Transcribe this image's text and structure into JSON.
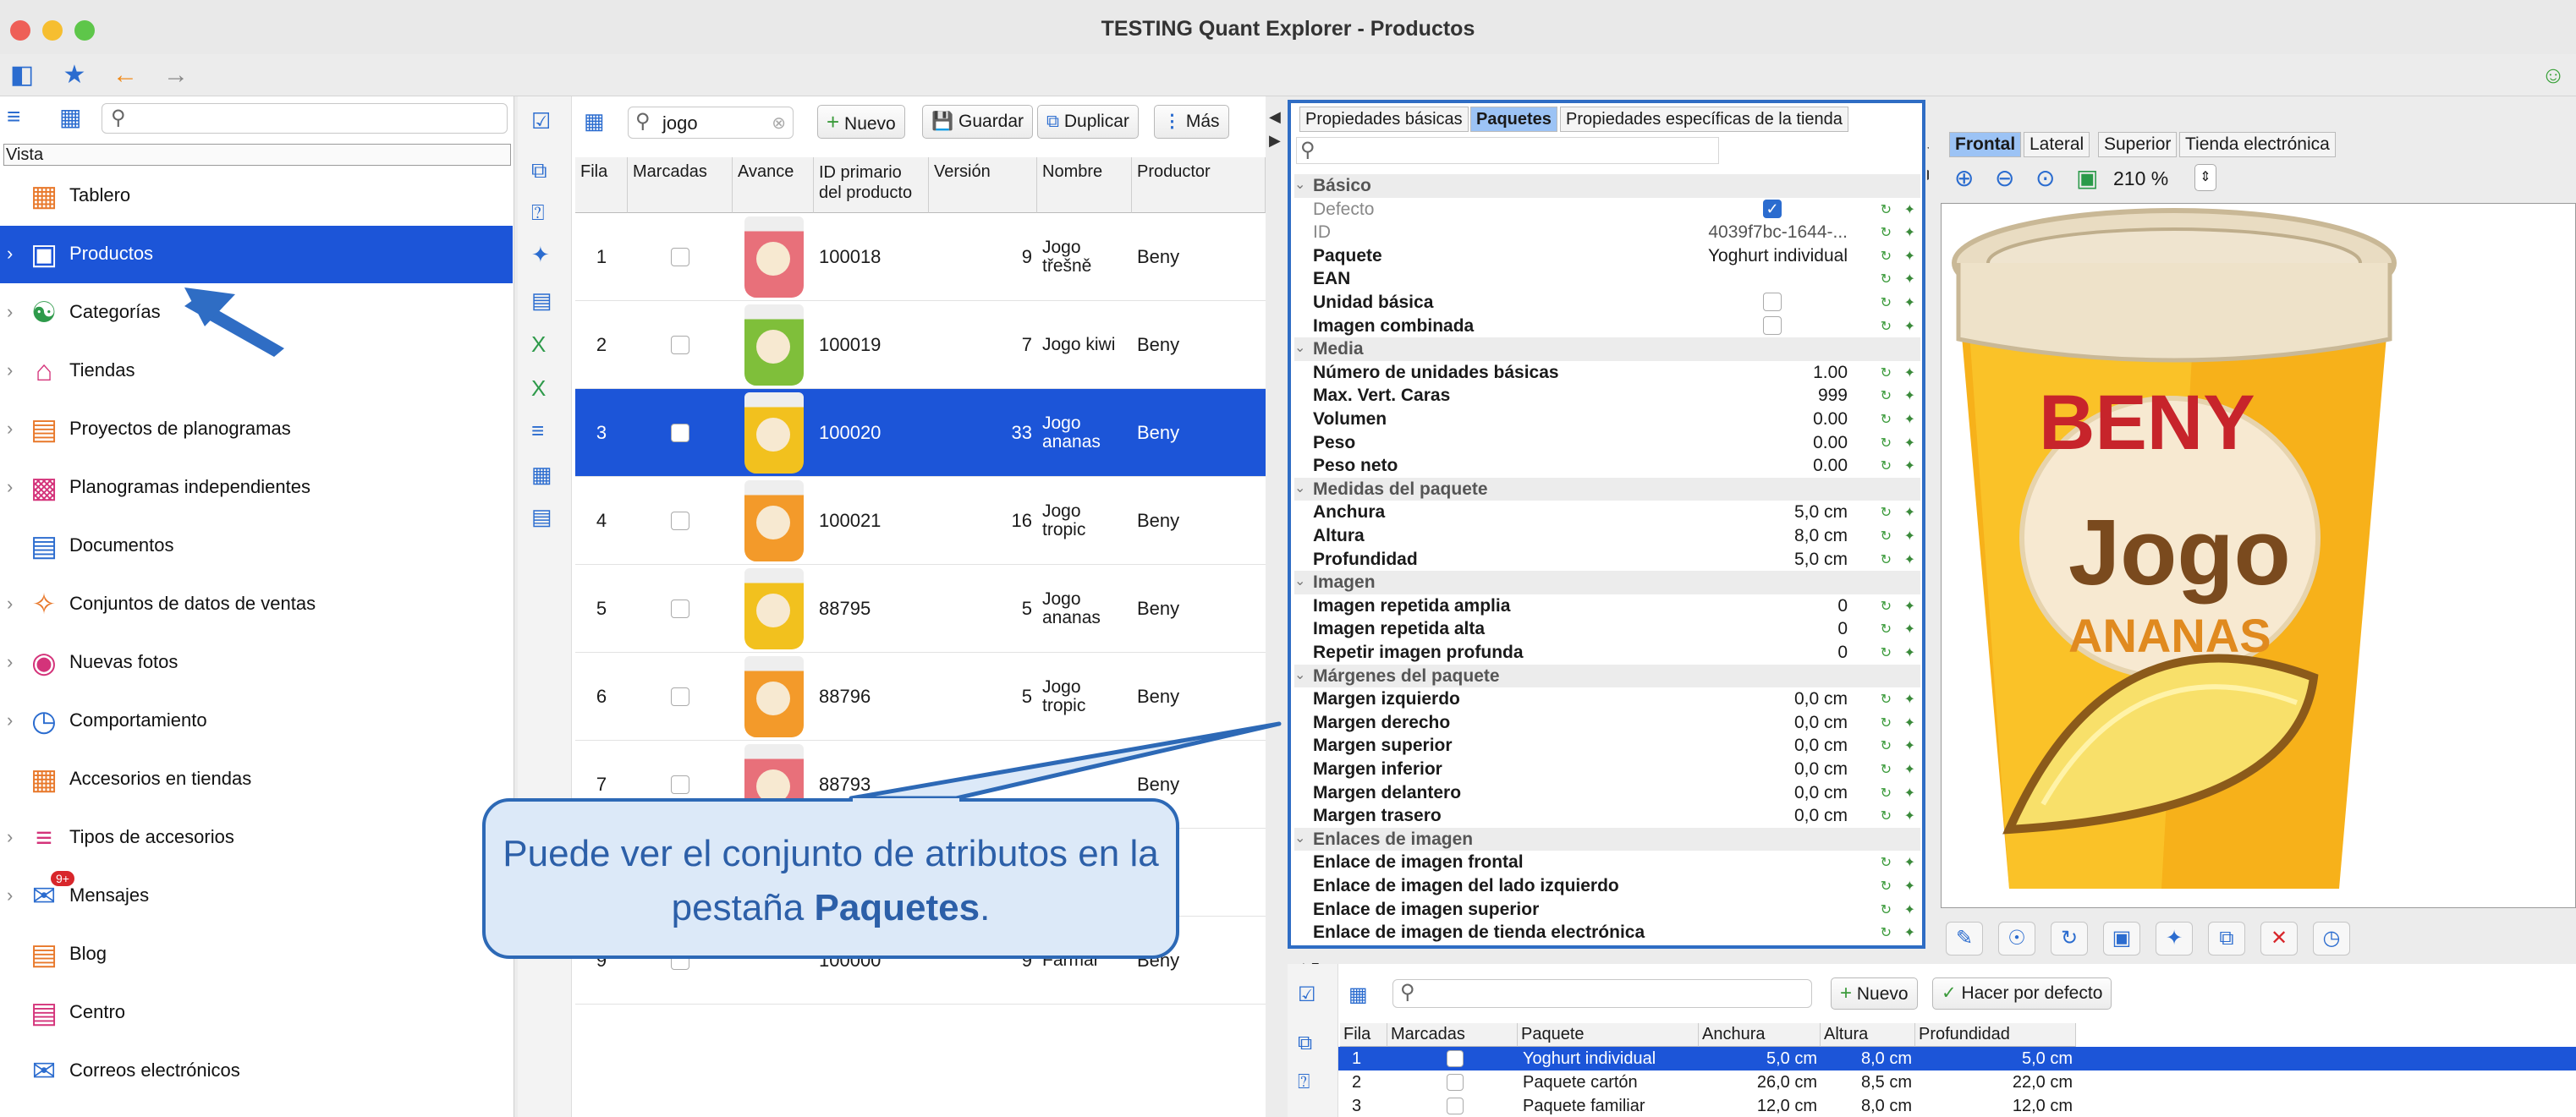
{
  "window": {
    "title": "TESTING Quant Explorer - Productos"
  },
  "sidebar": {
    "vista_label": "Vista",
    "items": [
      {
        "label": "Tablero",
        "icon": "dashboard-icon",
        "chevron": false,
        "selected": false
      },
      {
        "label": "Productos",
        "icon": "product-box-icon",
        "chevron": true,
        "selected": true
      },
      {
        "label": "Categorías",
        "icon": "category-tree-icon",
        "chevron": true,
        "selected": false
      },
      {
        "label": "Tiendas",
        "icon": "store-icon",
        "chevron": true,
        "selected": false
      },
      {
        "label": "Proyectos de planogramas",
        "icon": "planogram-project-icon",
        "chevron": true,
        "selected": false
      },
      {
        "label": "Planogramas independientes",
        "icon": "planogram-icon",
        "chevron": true,
        "selected": false
      },
      {
        "label": "Documentos",
        "icon": "documents-icon",
        "chevron": false,
        "selected": false
      },
      {
        "label": "Conjuntos de datos de ventas",
        "icon": "sales-data-icon",
        "chevron": true,
        "selected": false
      },
      {
        "label": "Nuevas fotos",
        "icon": "camera-icon",
        "chevron": true,
        "selected": false
      },
      {
        "label": "Comportamiento",
        "icon": "behavior-icon",
        "chevron": true,
        "selected": false
      },
      {
        "label": "Accesorios en tiendas",
        "icon": "accessories-icon",
        "chevron": false,
        "selected": false
      },
      {
        "label": "Tipos de accesorios",
        "icon": "accessory-types-icon",
        "chevron": true,
        "selected": false
      },
      {
        "label": "Mensajes",
        "icon": "messages-icon",
        "chevron": true,
        "selected": false,
        "badge": "9+"
      },
      {
        "label": "Blog",
        "icon": "blog-icon",
        "chevron": false,
        "selected": false
      },
      {
        "label": "Centro",
        "icon": "center-icon",
        "chevron": false,
        "selected": false
      },
      {
        "label": "Correos electrónicos",
        "icon": "email-icon",
        "chevron": false,
        "selected": false
      }
    ]
  },
  "list_toolbar": {
    "search_value": "jogo",
    "nuevo": "Nuevo",
    "guardar": "Guardar",
    "duplicar": "Duplicar",
    "mas": "Más"
  },
  "product_table": {
    "headers": {
      "fila": "Fila",
      "marcadas": "Marcadas",
      "avance": "Avance",
      "id": "ID primario del producto",
      "version": "Versión",
      "nombre": "Nombre",
      "productor": "Productor"
    },
    "rows": [
      {
        "fila": "1",
        "id": "100018",
        "version": "9",
        "nombre": "Jogo třešně",
        "productor": "Beny",
        "color": "#e8707a",
        "selected": false
      },
      {
        "fila": "2",
        "id": "100019",
        "version": "7",
        "nombre": "Jogo kiwi",
        "productor": "Beny",
        "color": "#7fbf3a",
        "selected": false
      },
      {
        "fila": "3",
        "id": "100020",
        "version": "33",
        "nombre": "Jogo ananas",
        "productor": "Beny",
        "color": "#f2c11e",
        "selected": true
      },
      {
        "fila": "4",
        "id": "100021",
        "version": "16",
        "nombre": "Jogo tropic",
        "productor": "Beny",
        "color": "#f39a2a",
        "selected": false
      },
      {
        "fila": "5",
        "id": "88795",
        "version": "5",
        "nombre": "Jogo ananas",
        "productor": "Beny",
        "color": "#f2c11e",
        "selected": false
      },
      {
        "fila": "6",
        "id": "88796",
        "version": "5",
        "nombre": "Jogo tropic",
        "productor": "Beny",
        "color": "#f39a2a",
        "selected": false
      },
      {
        "fila": "7",
        "id": "88793",
        "version": "",
        "nombre": "",
        "productor": "Beny",
        "color": "#e8707a",
        "selected": false
      },
      {
        "fila": "",
        "id": "",
        "version": "",
        "nombre": "",
        "productor": "Beny",
        "color": "",
        "selected": false
      },
      {
        "fila": "9",
        "id": "100000",
        "version": "9",
        "nombre": "Farmář",
        "productor": "Beny",
        "color": "",
        "selected": false
      }
    ]
  },
  "properties": {
    "tabs": [
      "Propiedades básicas",
      "Paquetes",
      "Propiedades específicas de la tienda"
    ],
    "active_tab": 1,
    "rows": [
      {
        "type": "section",
        "label": "Básico"
      },
      {
        "label": "Defecto",
        "value": "",
        "check": "checked",
        "muted": true
      },
      {
        "label": "ID",
        "value": "4039f7bc-1644-...",
        "muted": true
      },
      {
        "label": "Paquete",
        "value": "Yoghurt individual"
      },
      {
        "label": "EAN",
        "value": ""
      },
      {
        "label": "Unidad básica",
        "value": "",
        "check": "empty"
      },
      {
        "label": "Imagen combinada",
        "value": "",
        "check": "empty"
      },
      {
        "type": "section",
        "label": "Media"
      },
      {
        "label": "Número de unidades básicas",
        "value": "1.00"
      },
      {
        "label": "Max. Vert. Caras",
        "value": "999"
      },
      {
        "label": "Volumen",
        "value": "0.00"
      },
      {
        "label": "Peso",
        "value": "0.00"
      },
      {
        "label": "Peso neto",
        "value": "0.00"
      },
      {
        "type": "section",
        "label": "Medidas del paquete"
      },
      {
        "label": "Anchura",
        "value": "5,0 cm"
      },
      {
        "label": "Altura",
        "value": "8,0 cm"
      },
      {
        "label": "Profundidad",
        "value": "5,0 cm"
      },
      {
        "type": "section",
        "label": "Imagen"
      },
      {
        "label": "Imagen repetida amplia",
        "value": "0"
      },
      {
        "label": "Imagen repetida alta",
        "value": "0"
      },
      {
        "label": "Repetir imagen profunda",
        "value": "0"
      },
      {
        "type": "section",
        "label": "Márgenes del paquete"
      },
      {
        "label": "Margen izquierdo",
        "value": "0,0 cm"
      },
      {
        "label": "Margen derecho",
        "value": "0,0 cm"
      },
      {
        "label": "Margen superior",
        "value": "0,0 cm"
      },
      {
        "label": "Margen inferior",
        "value": "0,0 cm"
      },
      {
        "label": "Margen delantero",
        "value": "0,0 cm"
      },
      {
        "label": "Margen trasero",
        "value": "0,0 cm"
      },
      {
        "type": "section",
        "label": "Enlaces de imagen"
      },
      {
        "label": "Enlace de imagen frontal",
        "value": ""
      },
      {
        "label": "Enlace de imagen del lado izquierdo",
        "value": ""
      },
      {
        "label": "Enlace de imagen superior",
        "value": ""
      },
      {
        "label": "Enlace de imagen de tienda electrónica",
        "value": ""
      }
    ]
  },
  "image_panel": {
    "tabs": [
      "Frontal",
      "Lateral",
      "Superior",
      "Tienda electrónica"
    ],
    "active_tab": 0,
    "zoom": "210 %",
    "product_brand": "BENY",
    "product_name": "Jogo",
    "product_flavor": "ANANAS"
  },
  "package_table": {
    "nuevo": "Nuevo",
    "hacer_por_defecto": "Hacer por defecto",
    "headers": [
      "Fila",
      "Marcadas",
      "Paquete",
      "Anchura",
      "Altura",
      "Profundidad"
    ],
    "rows": [
      {
        "fila": "1",
        "paquete": "Yoghurt individual",
        "anchura": "5,0 cm",
        "altura": "8,0 cm",
        "profundidad": "5,0 cm",
        "selected": true
      },
      {
        "fila": "2",
        "paquete": "Paquete cartón",
        "anchura": "26,0 cm",
        "altura": "8,5 cm",
        "profundidad": "22,0 cm",
        "selected": false
      },
      {
        "fila": "3",
        "paquete": "Paquete familiar",
        "anchura": "12,0 cm",
        "altura": "8,0 cm",
        "profundidad": "12,0 cm",
        "selected": false
      }
    ]
  },
  "callout": {
    "text_before": "Puede ver el conjunto de atributos en la pestaña ",
    "text_bold": "Paquetes",
    "text_after": "."
  }
}
